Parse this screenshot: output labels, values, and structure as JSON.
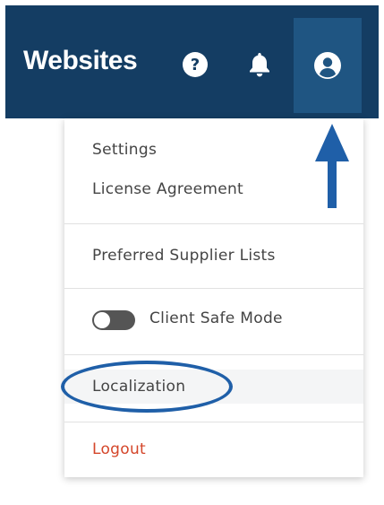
{
  "header": {
    "brand": "Websites",
    "help_icon_glyph": "?",
    "icons": [
      "help-circle-icon",
      "bell-icon",
      "user-circle-icon"
    ],
    "background": "#143d63",
    "active_button_background": "#1f5582"
  },
  "menu": {
    "settings": "Settings",
    "license": "License Agreement",
    "preferred_suppliers": "Preferred Supplier Lists",
    "client_safe_mode": "Client Safe Mode",
    "client_safe_mode_enabled": false,
    "localization": "Localization",
    "logout": "Logout",
    "logout_color": "#d4462a"
  },
  "annotations": {
    "color": "#1f5fa8",
    "shapes": [
      "arrow-up-annotation",
      "oval-highlight-annotation"
    ]
  }
}
